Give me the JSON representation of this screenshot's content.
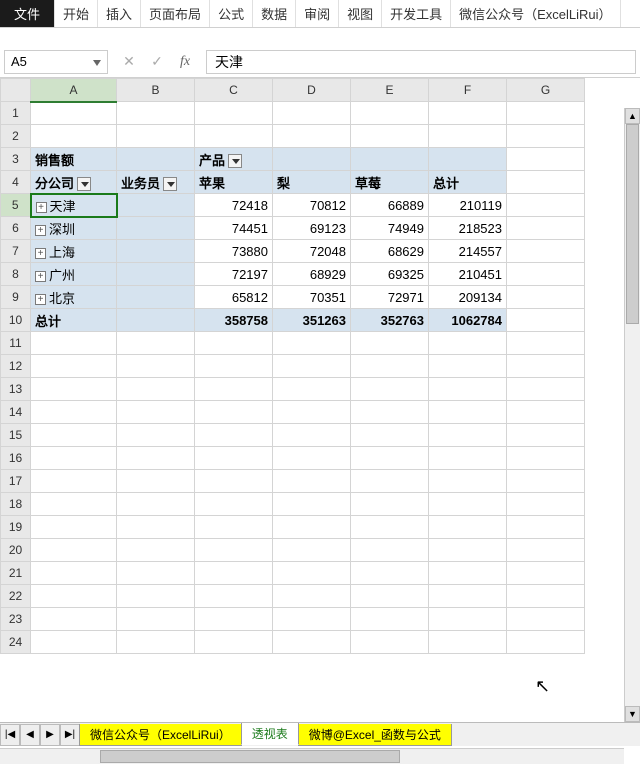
{
  "ribbon": {
    "file": "文件",
    "tabs": [
      "开始",
      "插入",
      "页面布局",
      "公式",
      "数据",
      "审阅",
      "视图",
      "开发工具",
      "微信公众号（ExcelLiRui）"
    ]
  },
  "namebox": "A5",
  "formula": "天津",
  "columns": [
    "A",
    "B",
    "C",
    "D",
    "E",
    "F",
    "G"
  ],
  "pivot": {
    "r3": {
      "a": "销售额",
      "c": "产品"
    },
    "r4": {
      "a": "分公司",
      "b": "业务员",
      "c": "苹果",
      "d": "梨",
      "e": "草莓",
      "f": "总计"
    },
    "rows": [
      {
        "label": "天津",
        "c": 72418,
        "d": 70812,
        "e": 66889,
        "f": 210119
      },
      {
        "label": "深圳",
        "c": 74451,
        "d": 69123,
        "e": 74949,
        "f": 218523
      },
      {
        "label": "上海",
        "c": 73880,
        "d": 72048,
        "e": 68629,
        "f": 214557
      },
      {
        "label": "广州",
        "c": 72197,
        "d": 68929,
        "e": 69325,
        "f": 210451
      },
      {
        "label": "北京",
        "c": 65812,
        "d": 70351,
        "e": 72971,
        "f": 209134
      }
    ],
    "total": {
      "label": "总计",
      "c": 358758,
      "d": 351263,
      "e": 352763,
      "f": 1062784
    }
  },
  "sheets": {
    "s1": "微信公众号（ExcelLiRui）",
    "s2": "透视表",
    "s3": "微博@Excel_函数与公式"
  },
  "chart_data": {
    "type": "table",
    "title": "销售额",
    "col_field": "产品",
    "row_fields": [
      "分公司",
      "业务员"
    ],
    "columns": [
      "苹果",
      "梨",
      "草莓",
      "总计"
    ],
    "rows": [
      {
        "分公司": "天津",
        "苹果": 72418,
        "梨": 70812,
        "草莓": 66889,
        "总计": 210119
      },
      {
        "分公司": "深圳",
        "苹果": 74451,
        "梨": 69123,
        "草莓": 74949,
        "总计": 218523
      },
      {
        "分公司": "上海",
        "苹果": 73880,
        "梨": 72048,
        "草莓": 68629,
        "总计": 214557
      },
      {
        "分公司": "广州",
        "苹果": 72197,
        "梨": 68929,
        "草莓": 69325,
        "总计": 210451
      },
      {
        "分公司": "北京",
        "苹果": 65812,
        "梨": 70351,
        "草莓": 72971,
        "总计": 209134
      }
    ],
    "grand_total": {
      "苹果": 358758,
      "梨": 351263,
      "草莓": 352763,
      "总计": 1062784
    }
  }
}
